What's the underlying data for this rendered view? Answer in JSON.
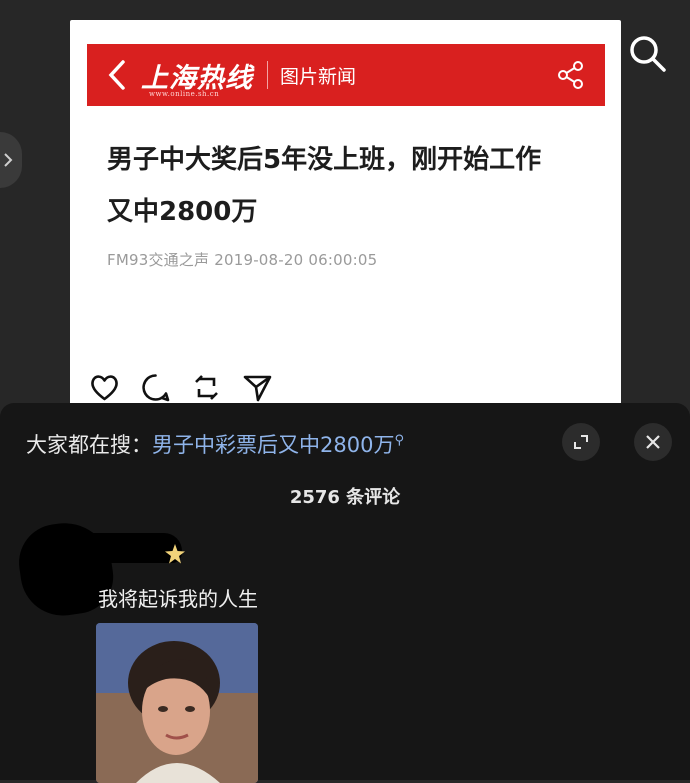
{
  "article": {
    "header_logo": "上海热线",
    "header_logo_sub": "www.online.sh.cn",
    "header_section": "图片新闻",
    "title_line1": "男子中大奖后5年没上班，刚开始工作",
    "title_line2": "又中2800万",
    "meta": "FM93交通之声 2019-08-20 06:00:05"
  },
  "actions": {
    "icons": [
      "heart-icon",
      "comment-icon",
      "repost-icon",
      "send-icon"
    ]
  },
  "comments_sheet": {
    "search_prefix": "大家都在搜：",
    "search_query": "男子中彩票后又中2800万",
    "search_query_icon": "⚲",
    "count_label": "2576 条评论",
    "comment": {
      "text": "我将起诉我的人生"
    }
  },
  "colors": {
    "header_red": "#d9201f",
    "link_blue": "#8fb4ea",
    "sheet_bg": "#161616"
  }
}
